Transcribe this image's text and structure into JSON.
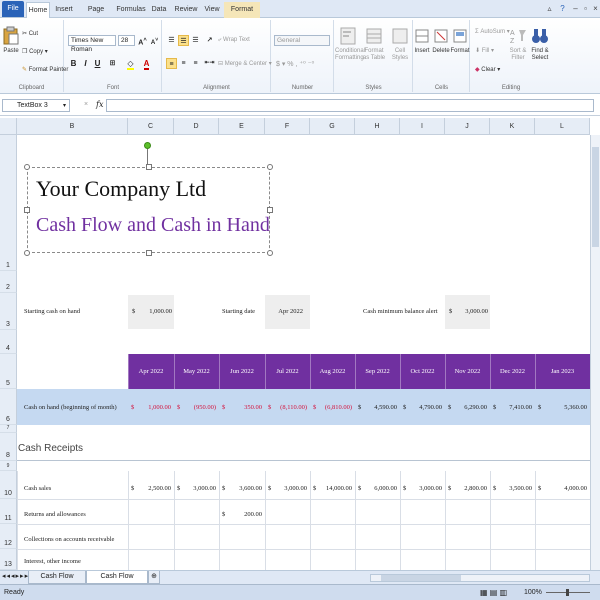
{
  "tabs": [
    "File",
    "Home",
    "Insert",
    "Page Layout",
    "Formulas",
    "Data",
    "Review",
    "View",
    "Format"
  ],
  "ribbon": {
    "clipboard": {
      "label": "Clipboard",
      "paste": "Paste",
      "cut": "Cut",
      "copy": "Copy",
      "format_painter": "Format Painter"
    },
    "font": {
      "label": "Font",
      "family": "Times New Roman",
      "size": "28"
    },
    "alignment": {
      "label": "Alignment",
      "wrap_text": "Wrap Text",
      "merge_center": "Merge & Center"
    },
    "number": {
      "label": "Number",
      "format": "General"
    },
    "styles": {
      "label": "Styles",
      "conditional": "Conditional Formatting",
      "format_table": "Format as Table",
      "cell_styles": "Cell Styles"
    },
    "cells": {
      "label": "Cells",
      "insert": "Insert",
      "delete": "Delete",
      "format": "Format"
    },
    "editing": {
      "label": "Editing",
      "autosum": "AutoSum",
      "fill": "Fill",
      "clear": "Clear",
      "sort_filter": "Sort & Filter",
      "find_select": "Find & Select"
    }
  },
  "formula_bar": {
    "name_box": "TextBox 3",
    "fx": "fx",
    "value": ""
  },
  "columns": [
    "B",
    "C",
    "D",
    "E",
    "F",
    "G",
    "H",
    "I",
    "J",
    "K",
    "L"
  ],
  "rows": [
    "1",
    "2",
    "3",
    "4",
    "5",
    "6",
    "7",
    "8",
    "9",
    "10",
    "11",
    "12",
    "13"
  ],
  "textbox": {
    "company": "Your Company Ltd",
    "subtitle": "Cash Flow and Cash in Hand"
  },
  "inputs": {
    "starting_cash_label": "Starting cash on hand",
    "starting_cash_cur": "$",
    "starting_cash_value": "1,000.00",
    "starting_date_label": "Starting date",
    "starting_date_value": "Apr 2022",
    "min_balance_label": "Cash minimum balance alert",
    "min_balance_cur": "$",
    "min_balance_value": "3,000.00"
  },
  "months": [
    "Apr 2022",
    "May 2022",
    "Jun 2022",
    "Jul 2022",
    "Aug 2022",
    "Sep 2022",
    "Oct 2022",
    "Nov 2022",
    "Dec 2022",
    "Jan 2023"
  ],
  "cash_on_hand": {
    "label": "Cash on hand (beginning of month)",
    "values": [
      "1,000.00",
      "(950.00)",
      "350.00",
      "(8,110.00)",
      "(6,810.00)",
      "4,590.00",
      "4,790.00",
      "6,290.00",
      "7,410.00",
      "5,360.00"
    ],
    "alert": [
      true,
      true,
      true,
      true,
      true,
      false,
      false,
      false,
      false,
      false
    ]
  },
  "cash_receipts": {
    "title": "Cash Receipts",
    "rows": [
      {
        "label": "Cash sales",
        "values": [
          "2,500.00",
          "3,000.00",
          "3,600.00",
          "3,000.00",
          "14,000.00",
          "6,000.00",
          "3,000.00",
          "2,800.00",
          "3,500.00",
          "4,000.00"
        ]
      },
      {
        "label": "Returns and allowances",
        "values": [
          "",
          "",
          "200.00",
          "",
          "",
          "",
          "",
          "",
          "",
          ""
        ]
      },
      {
        "label": "Collections on accounts receivable",
        "values": [
          "",
          "",
          "",
          "",
          "",
          "",
          "",
          "",
          "",
          ""
        ]
      },
      {
        "label": "Interest, other income",
        "values": [
          "",
          "",
          "",
          "",
          "",
          "",
          "",
          "",
          "",
          ""
        ]
      }
    ],
    "currency": "$"
  },
  "sheets": [
    "Cash Flow Summary",
    "Cash Flow Forecast"
  ],
  "status": {
    "ready": "Ready",
    "zoom": "100%"
  },
  "colors": {
    "header_purple": "#7030a0",
    "row_blue": "#c5d9f1",
    "alert_red": "#d4113b",
    "subtitle_purple": "#7030a0"
  }
}
